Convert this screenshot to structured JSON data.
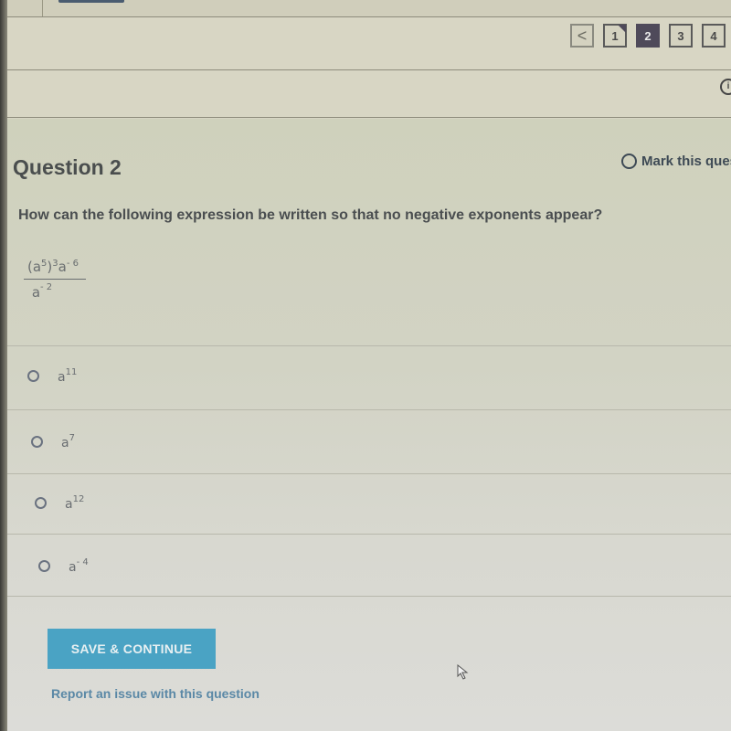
{
  "navigation": {
    "prev_label": "<",
    "pages": [
      {
        "label": "1",
        "state": "answered"
      },
      {
        "label": "2",
        "state": "current"
      },
      {
        "label": "3",
        "state": "default"
      },
      {
        "label": "4",
        "state": "default"
      }
    ]
  },
  "question": {
    "title": "Question 2",
    "mark_label": "Mark this question",
    "prompt": "How can the following expression be written so that no negative exponents appear?",
    "expression": {
      "numerator": {
        "base1": "(a",
        "exp1": "5",
        "close": ")",
        "exp2": "3",
        "base2": "a",
        "exp3": "- 6"
      },
      "denominator": {
        "base": "a",
        "exp": "- 2"
      }
    },
    "options": [
      {
        "base": "a",
        "exp": "11",
        "selected": false
      },
      {
        "base": "a",
        "exp": "7",
        "selected": false
      },
      {
        "base": "a",
        "exp": "12",
        "selected": false
      },
      {
        "base": "a",
        "exp": "- 4",
        "selected": false
      }
    ]
  },
  "actions": {
    "save_label": "SAVE & CONTINUE",
    "report_label": "Report an issue with this question"
  },
  "colors": {
    "accent": "#4aa3c4",
    "current_page": "#4f4a5a",
    "link": "#5a88a6"
  }
}
